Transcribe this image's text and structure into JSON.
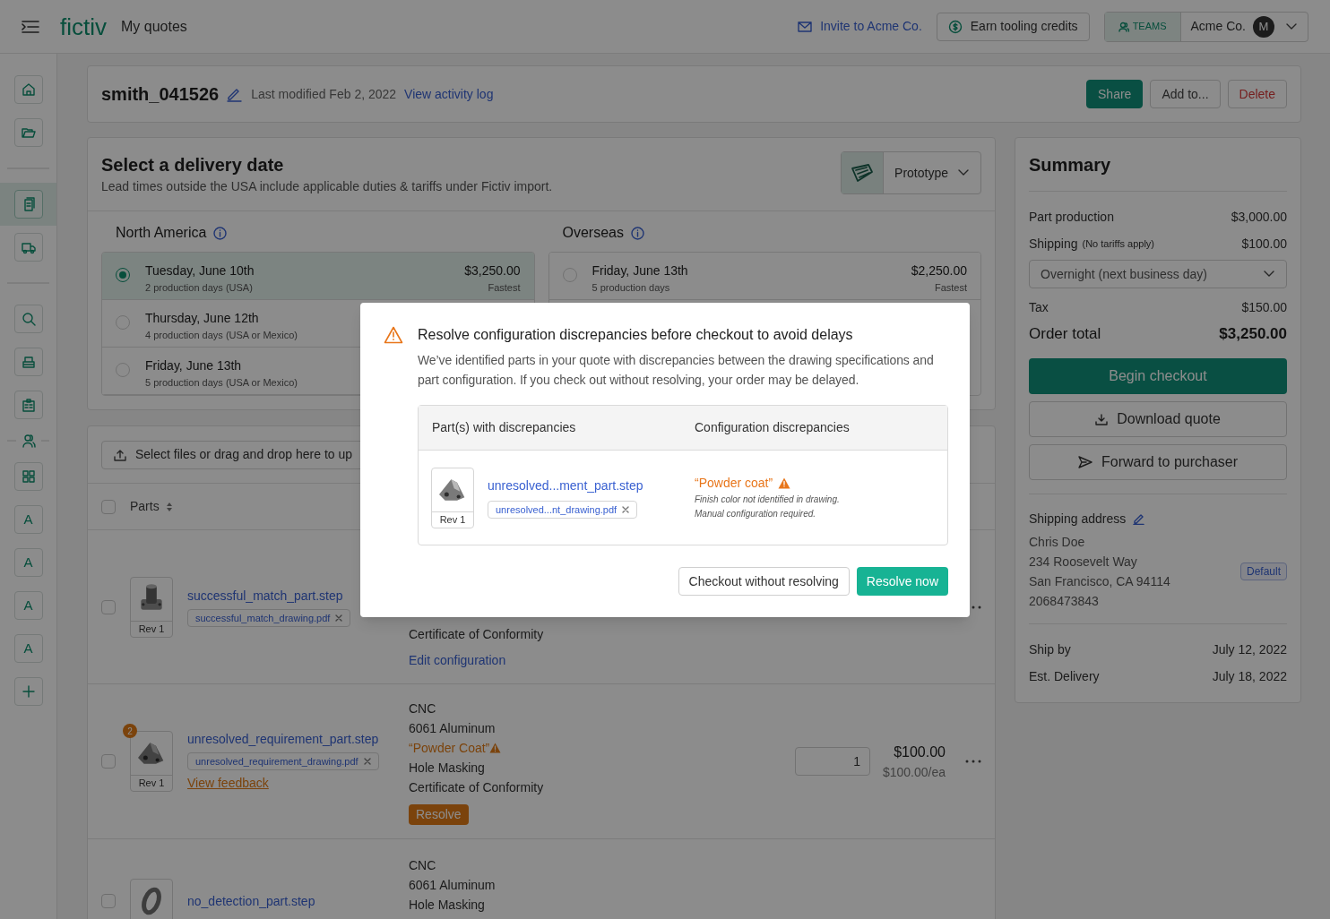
{
  "top_bar": {
    "brand": "fictiv",
    "page_title": "My quotes",
    "invite_link": "Invite to Acme Co.",
    "credits_button": "Earn tooling credits",
    "teams_badge": "TEAMS",
    "account": "Acme Co.",
    "avatar_initial": "M"
  },
  "sidebar": {
    "items": [
      {
        "kind": "icon",
        "selected": false
      },
      {
        "kind": "icon",
        "selected": false
      },
      {
        "kind": "divider"
      },
      {
        "kind": "icon",
        "selected": true
      },
      {
        "kind": "icon",
        "selected": false
      },
      {
        "kind": "divider"
      },
      {
        "kind": "icon",
        "selected": false
      },
      {
        "kind": "icon",
        "selected": false
      },
      {
        "kind": "icon",
        "selected": false
      },
      {
        "kind": "people_divider"
      },
      {
        "kind": "icon",
        "selected": false
      },
      {
        "kind": "letter",
        "label": "A",
        "selected": false
      },
      {
        "kind": "letter",
        "label": "A",
        "selected": false
      },
      {
        "kind": "letter",
        "label": "A",
        "selected": false
      },
      {
        "kind": "letter",
        "label": "A",
        "selected": false
      },
      {
        "kind": "icon",
        "selected": false
      }
    ]
  },
  "quote_header": {
    "name": "smith_041526",
    "modified": "Last modified Feb 2, 2022",
    "activity_link": "View activity log",
    "actions": [
      {
        "label": "Share",
        "kind": "primary"
      },
      {
        "label": "Add to...",
        "kind": "default"
      },
      {
        "label": "Delete",
        "kind": "danger"
      }
    ]
  },
  "delivery": {
    "title": "Select a delivery date",
    "subtitle": "Lead times outside the USA include applicable duties & tariffs under Fictiv import.",
    "process_select": "Prototype",
    "regions": [
      {
        "name": "North America",
        "options": [
          {
            "date": "Tuesday, June 10th",
            "detail": "2 production days (USA)",
            "price": "$3,250.00",
            "tag": "Fastest",
            "selected": true
          },
          {
            "date": "Thursday, June 12th",
            "detail": "4 production days (USA or Mexico)",
            "selected": false
          },
          {
            "date": "Friday, June 13th",
            "detail": "5 production days (USA or Mexico)",
            "selected": false
          }
        ]
      },
      {
        "name": "Overseas",
        "options": [
          {
            "date": "Friday, June 13th",
            "detail": "5 production days",
            "price": "$2,250.00",
            "tag": "Fastest",
            "selected": false
          }
        ]
      }
    ]
  },
  "parts": {
    "upload_hint": "Select files or drag and drop here to up",
    "header": {
      "label": "Parts",
      "checked": false
    },
    "rows": [
      {
        "checked": false,
        "rev": "Rev 1",
        "file": "successful_match_part.step",
        "drawing": "successful_match_drawing.pdf",
        "config": [
          {
            "text": "Certificate of Conformity",
            "kind": "spec"
          }
        ],
        "action": {
          "kind": "link",
          "label": "Edit configuration"
        }
      },
      {
        "checked": false,
        "rev": "Rev 1",
        "badge": "2",
        "file": "unresolved_requirement_part.step",
        "drawing": "unresolved_requirement_drawing.pdf",
        "feedback_link": "View feedback",
        "config": [
          {
            "text": "CNC",
            "kind": "spec"
          },
          {
            "text": "6061 Aluminum",
            "kind": "spec"
          },
          {
            "text": "“Powder Coat”",
            "kind": "warning"
          },
          {
            "text": "Hole Masking",
            "kind": "spec"
          },
          {
            "text": "Certificate of Conformity",
            "kind": "spec"
          }
        ],
        "action": {
          "kind": "button",
          "label": "Resolve"
        },
        "quantity": "1",
        "price": "$100.00",
        "unit_price": "$100.00/ea"
      },
      {
        "checked": false,
        "file": "no_detection_part.step",
        "config": [
          {
            "text": "CNC",
            "kind": "spec"
          },
          {
            "text": "6061 Aluminum",
            "kind": "spec"
          },
          {
            "text": "Hole Masking",
            "kind": "spec"
          }
        ]
      }
    ]
  },
  "summary": {
    "title": "Summary",
    "lines": [
      {
        "label": "Part production",
        "value": "$3,000.00"
      },
      {
        "label": "Shipping",
        "note": "(No tariffs apply)",
        "value": "$100.00"
      }
    ],
    "shipping_method": "Overnight (next business day)",
    "tax": {
      "label": "Tax",
      "value": "$150.00"
    },
    "total": {
      "label": "Order total",
      "value": "$3,250.00"
    },
    "buttons": [
      {
        "label": "Begin checkout",
        "kind": "primary"
      },
      {
        "label": "Download quote",
        "kind": "download"
      },
      {
        "label": "Forward to purchaser",
        "kind": "forward"
      }
    ],
    "address": {
      "title": "Shipping address",
      "lines": [
        "Chris Doe",
        "234 Roosevelt Way",
        "San Francisco, CA 94114",
        "2068473843"
      ],
      "badge": "Default"
    },
    "dates": [
      {
        "label": "Ship by",
        "value": "July 12, 2022"
      },
      {
        "label": "Est. Delivery",
        "value": "July 18, 2022"
      }
    ]
  },
  "modal": {
    "title": "Resolve configuration discrepancies before checkout to avoid delays",
    "body": "We’ve identified parts in your quote with discrepancies between the drawing specifications and part configuration. If you check out without resolving, your order may be delayed.",
    "table": {
      "columns": [
        "Part(s) with discrepancies",
        "Configuration discrepancies"
      ],
      "rows": [
        {
          "rev": "Rev 1",
          "file": "unresolved...ment_part.step",
          "drawing": "unresolved...nt_drawing.pdf",
          "discrepancy": "“Powder coat”",
          "notes": [
            "Finish color not identified in drawing.",
            "Manual configuration required."
          ]
        }
      ]
    },
    "buttons": [
      {
        "label": "Checkout without resolving",
        "kind": "secondary"
      },
      {
        "label": "Resolve now",
        "kind": "primary"
      }
    ]
  }
}
